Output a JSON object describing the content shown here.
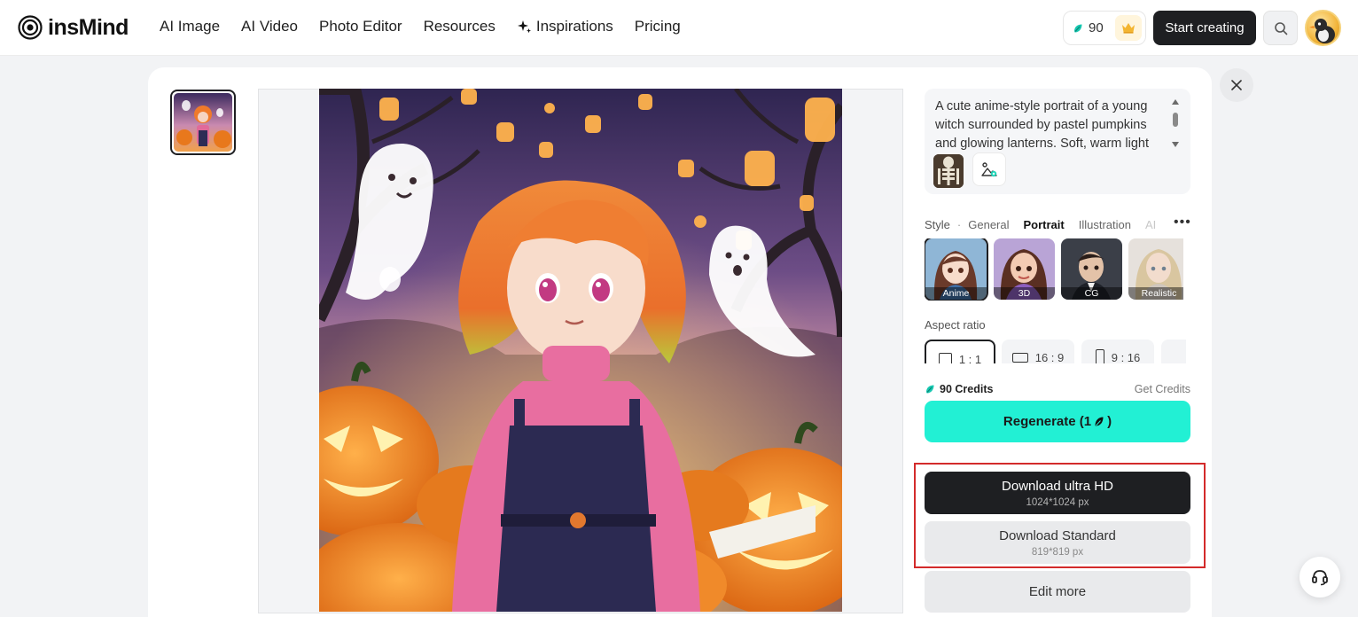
{
  "brand": {
    "name": "insMind"
  },
  "nav": {
    "items": [
      {
        "label": "AI Image"
      },
      {
        "label": "AI Video"
      },
      {
        "label": "Photo Editor"
      },
      {
        "label": "Resources"
      },
      {
        "label": "Inspirations",
        "icon": "sparkle-icon"
      },
      {
        "label": "Pricing"
      }
    ]
  },
  "header": {
    "credits": "90",
    "start_label": "Start creating"
  },
  "prompt": {
    "text": "A cute anime-style portrait of a young witch surrounded by pastel pumpkins and glowing lanterns. Soft, warm light"
  },
  "style": {
    "label": "Style",
    "tabs": [
      {
        "label": "General"
      },
      {
        "label": "Portrait"
      },
      {
        "label": "Illustration"
      },
      {
        "label": "AI"
      }
    ],
    "active_tab": "Portrait",
    "cards": [
      {
        "label": "Anime"
      },
      {
        "label": "3D"
      },
      {
        "label": "CG"
      },
      {
        "label": "Realistic"
      }
    ],
    "selected": "Anime"
  },
  "aspect": {
    "label": "Aspect ratio",
    "options": [
      {
        "label": "1 : 1"
      },
      {
        "label": "16 : 9"
      },
      {
        "label": "9 : 16"
      }
    ],
    "selected": "1 : 1"
  },
  "credits_bar": {
    "amount": "90 Credits",
    "get_label": "Get Credits"
  },
  "actions": {
    "regenerate": "Regenerate (1",
    "regenerate_close": ")",
    "download_hd": {
      "label": "Download ultra HD",
      "size": "1024*1024 px"
    },
    "download_std": {
      "label": "Download Standard",
      "size": "819*819 px"
    },
    "edit_more": "Edit more"
  },
  "colors": {
    "accent": "#22F0D4",
    "dark": "#1E1F22",
    "highlight": "#D32B2B"
  }
}
